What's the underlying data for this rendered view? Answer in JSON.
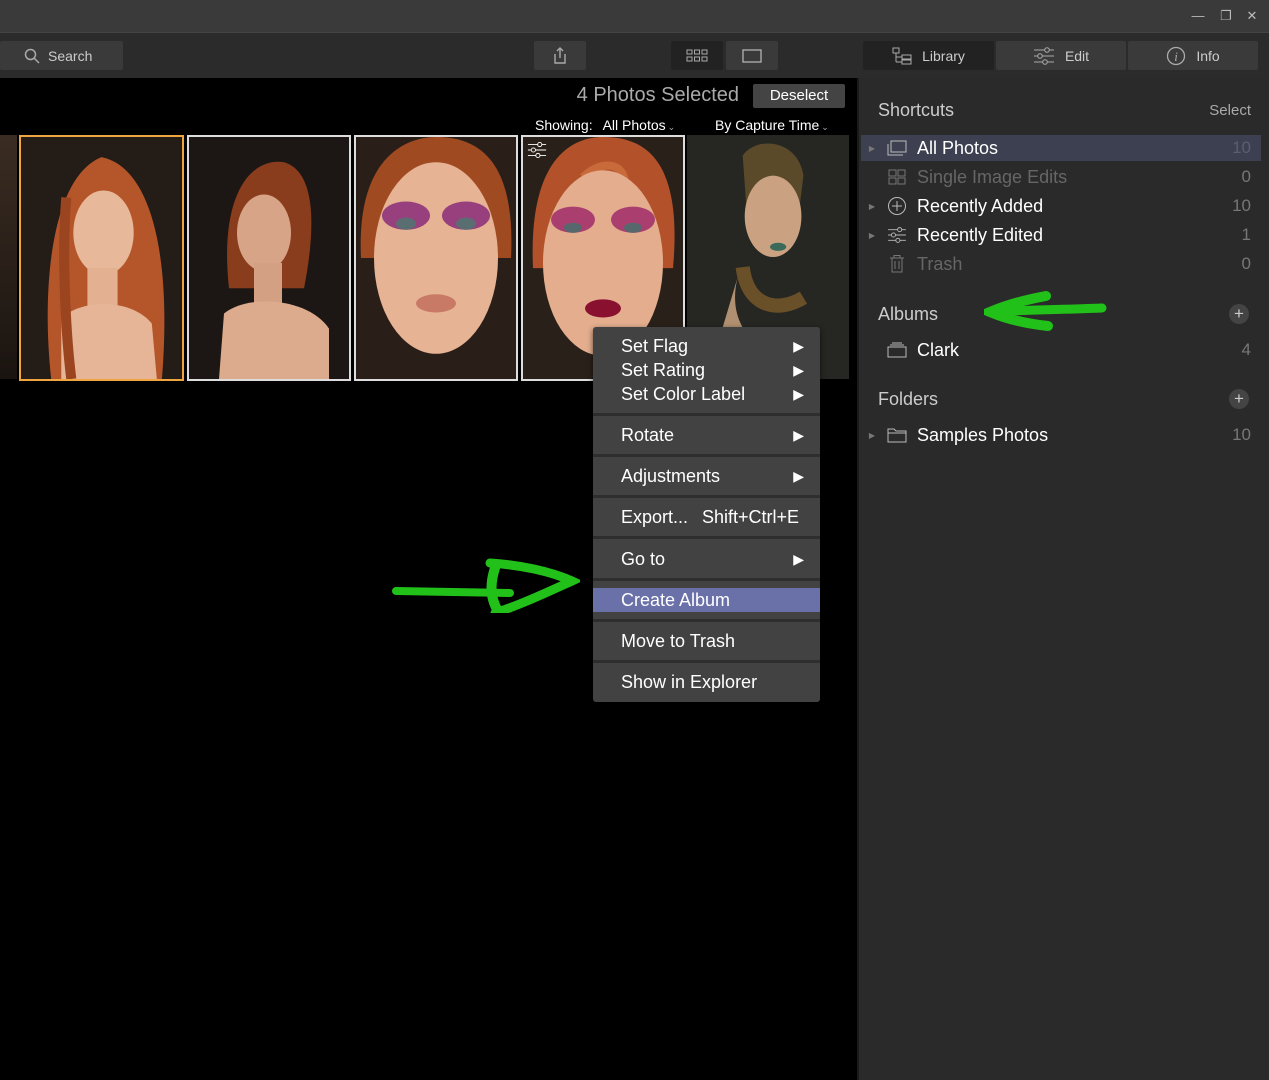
{
  "window": {
    "minimize_glyph": "—",
    "restore_glyph": "❐",
    "close_glyph": "✕"
  },
  "toolbar": {
    "search_label": "Search",
    "tabs": [
      {
        "label": "Library",
        "icon": "library-icon"
      },
      {
        "label": "Edit",
        "icon": "sliders-icon"
      },
      {
        "label": "Info",
        "icon": "info-icon"
      }
    ]
  },
  "header": {
    "selection_text": "4 Photos Selected",
    "deselect_label": "Deselect",
    "showing_label": "Showing:",
    "showing_value": "All Photos",
    "sort_value": "By Capture Time"
  },
  "photos": [
    {
      "selected": true,
      "hair": "#b5562a",
      "bg": "#241c17",
      "skin": "#e8b89a"
    },
    {
      "selected": true,
      "hair": "#8a3d1c",
      "bg": "#1c1714",
      "skin": "#d8a488"
    },
    {
      "selected": true,
      "hair": "#a04a22",
      "bg": "#2a1f18",
      "skin": "#e6b394"
    },
    {
      "selected": true,
      "hair": "#b3522a",
      "bg": "#2a201a",
      "skin": "#e3ad8e"
    },
    {
      "selected": false,
      "hair": "#5a4a2a",
      "bg": "#262622",
      "skin": "#caa282"
    }
  ],
  "sidebar": {
    "shortcuts_title": "Shortcuts",
    "select_label": "Select",
    "shortcuts": [
      {
        "label": "All Photos",
        "count": "10"
      },
      {
        "label": "Single Image Edits",
        "count": "0"
      },
      {
        "label": "Recently Added",
        "count": "10"
      },
      {
        "label": "Recently Edited",
        "count": "1"
      },
      {
        "label": "Trash",
        "count": "0"
      }
    ],
    "albums_title": "Albums",
    "albums": [
      {
        "label": "Clark",
        "count": "4"
      }
    ],
    "folders_title": "Folders",
    "folders": [
      {
        "label": "Samples Photos",
        "count": "10"
      }
    ],
    "add_glyph": "+"
  },
  "context_menu": {
    "arrow_glyph": "▶",
    "items": [
      {
        "label": "Set Flag"
      },
      {
        "label": "Set Rating"
      },
      {
        "label": "Set Color Label"
      },
      {
        "label": "Rotate"
      },
      {
        "label": "Adjustments"
      },
      {
        "label": "Export...",
        "shortcut": "Shift+Ctrl+E"
      },
      {
        "label": "Go to"
      },
      {
        "label": "Create Album"
      },
      {
        "label": "Move to Trash"
      },
      {
        "label": "Show in Explorer"
      }
    ]
  },
  "colors": {
    "annotation": "#22c11a",
    "accent": "#6a70a8",
    "selected_border": "#f0a640"
  }
}
